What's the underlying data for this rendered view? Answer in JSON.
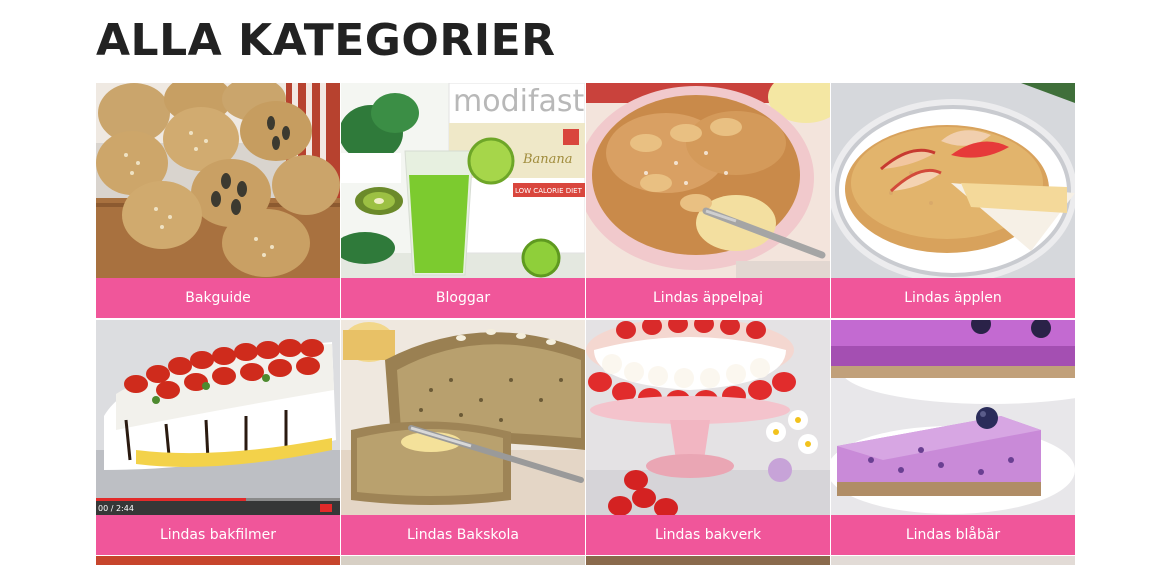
{
  "page": {
    "title": "ALLA KATEGORIER"
  },
  "categories": [
    {
      "label": "Bakguide",
      "image": "bread-rolls-image"
    },
    {
      "label": "Bloggar",
      "image": "green-smoothie-image",
      "brand_text": "modifast",
      "product_text": "Banana",
      "badge_text": "LOW CALORIE DIET"
    },
    {
      "label": "Lindas äppelpaj",
      "image": "apple-pie-image"
    },
    {
      "label": "Lindas äpplen",
      "image": "apple-cake-image"
    },
    {
      "label": "Lindas bakfilmer",
      "image": "strawberry-meringue-video-image",
      "video_time": "00 / 2:44"
    },
    {
      "label": "Lindas Bakskola",
      "image": "seed-bread-image"
    },
    {
      "label": "Lindas bakverk",
      "image": "strawberry-cake-stand-image"
    },
    {
      "label": "Lindas blåbär",
      "image": "blueberry-cheesecake-image"
    }
  ],
  "colors": {
    "label_bg": "#f0569a",
    "label_text": "#ffffff",
    "title_text": "#222222"
  }
}
